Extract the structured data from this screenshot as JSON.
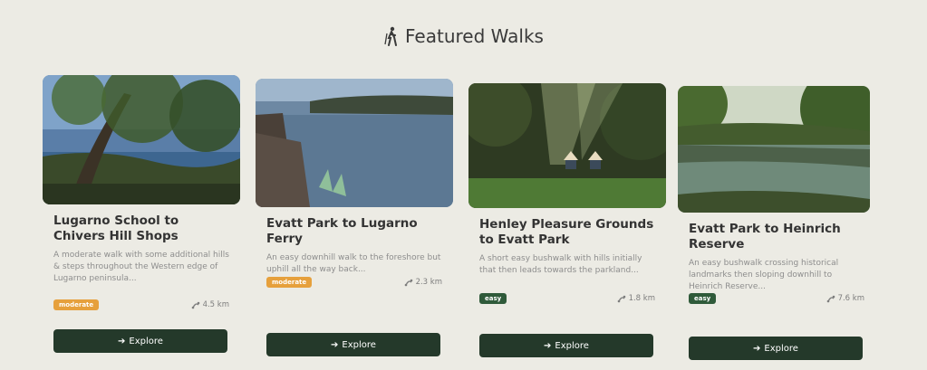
{
  "header": {
    "title": "Featured Walks",
    "icon": "hiker-icon"
  },
  "colors": {
    "primary": "#24392a",
    "moderate": "#e6a03c",
    "easy": "#2f5a3a"
  },
  "walks": [
    {
      "title": "Lugarno School to Chivers Hill Shops",
      "description": "A moderate walk with some additional hills & steps throughout the Western edge of Lugarno peninsula...",
      "difficulty": "moderate",
      "distance": "4.5 km",
      "button": "Explore"
    },
    {
      "title": "Evatt Park to Lugarno Ferry",
      "description": "An easy downhill walk to the foreshore but uphill all the way back...",
      "difficulty": "moderate",
      "distance": "2.3 km",
      "button": "Explore"
    },
    {
      "title": "Henley Pleasure Grounds to Evatt Park",
      "description": "A short easy bushwalk with hills initially that then leads towards the parkland...",
      "difficulty": "easy",
      "distance": "1.8 km",
      "button": "Explore"
    },
    {
      "title": "Evatt Park to Heinrich Reserve",
      "description": "An easy bushwalk crossing historical landmarks then sloping downhill to Heinrich Reserve...",
      "difficulty": "easy",
      "distance": "7.6 km",
      "button": "Explore"
    }
  ]
}
